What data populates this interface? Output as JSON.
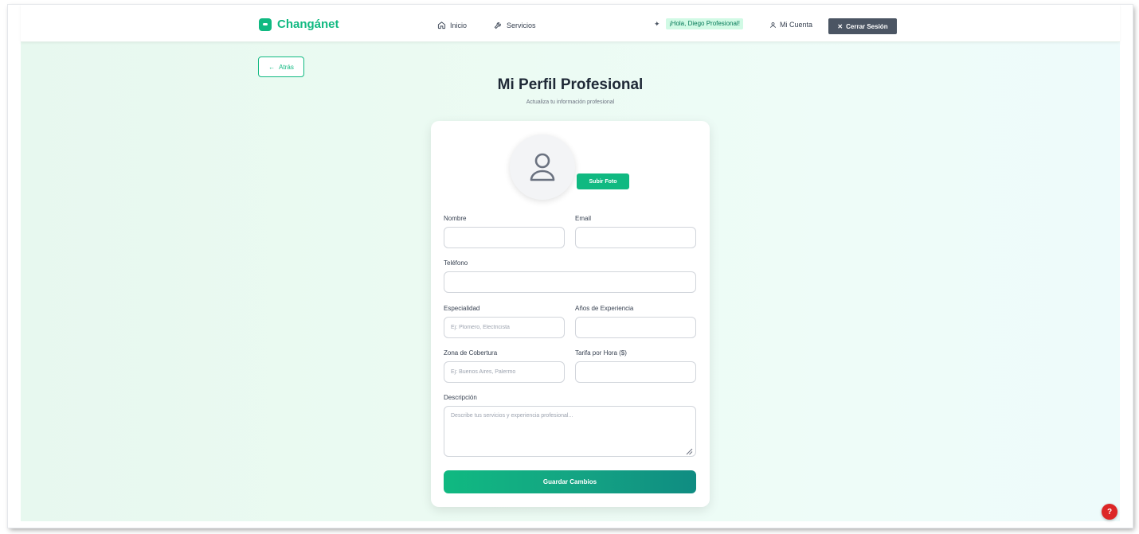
{
  "navbar": {
    "brand": "Changánet",
    "links": [
      {
        "label": "Inicio",
        "icon": "home-icon"
      },
      {
        "label": "Servicios",
        "icon": "wrench-icon"
      }
    ],
    "greeting": "¡Hola, Diego Profesional!",
    "account_label": "Mi Cuenta",
    "logout_label": "Cerrar Sesión"
  },
  "back_label": "Atrás",
  "page": {
    "title": "Mi Perfil Profesional",
    "subtitle": "Actualiza tu información profesional"
  },
  "form": {
    "upload_label": "Subir Foto",
    "nombre_label": "Nombre",
    "email_label": "Email",
    "telefono_label": "Teléfono",
    "especialidad_label": "Especialidad",
    "especialidad_placeholder": "Ej: Plomero, Electricista",
    "experiencia_label": "Años de Experiencia",
    "zona_label": "Zona de Cobertura",
    "zona_placeholder": "Ej: Buenos Aires, Palermo",
    "tarifa_label": "Tarifa por Hora ($)",
    "descripcion_label": "Descripción",
    "descripcion_placeholder": "Describe tus servicios y experiencia profesional...",
    "save_label": "Guardar Cambios"
  },
  "help_label": "?",
  "colors": {
    "brand": "#10b981",
    "logout_bg": "#4b5563",
    "help_bg": "#dc2626"
  }
}
